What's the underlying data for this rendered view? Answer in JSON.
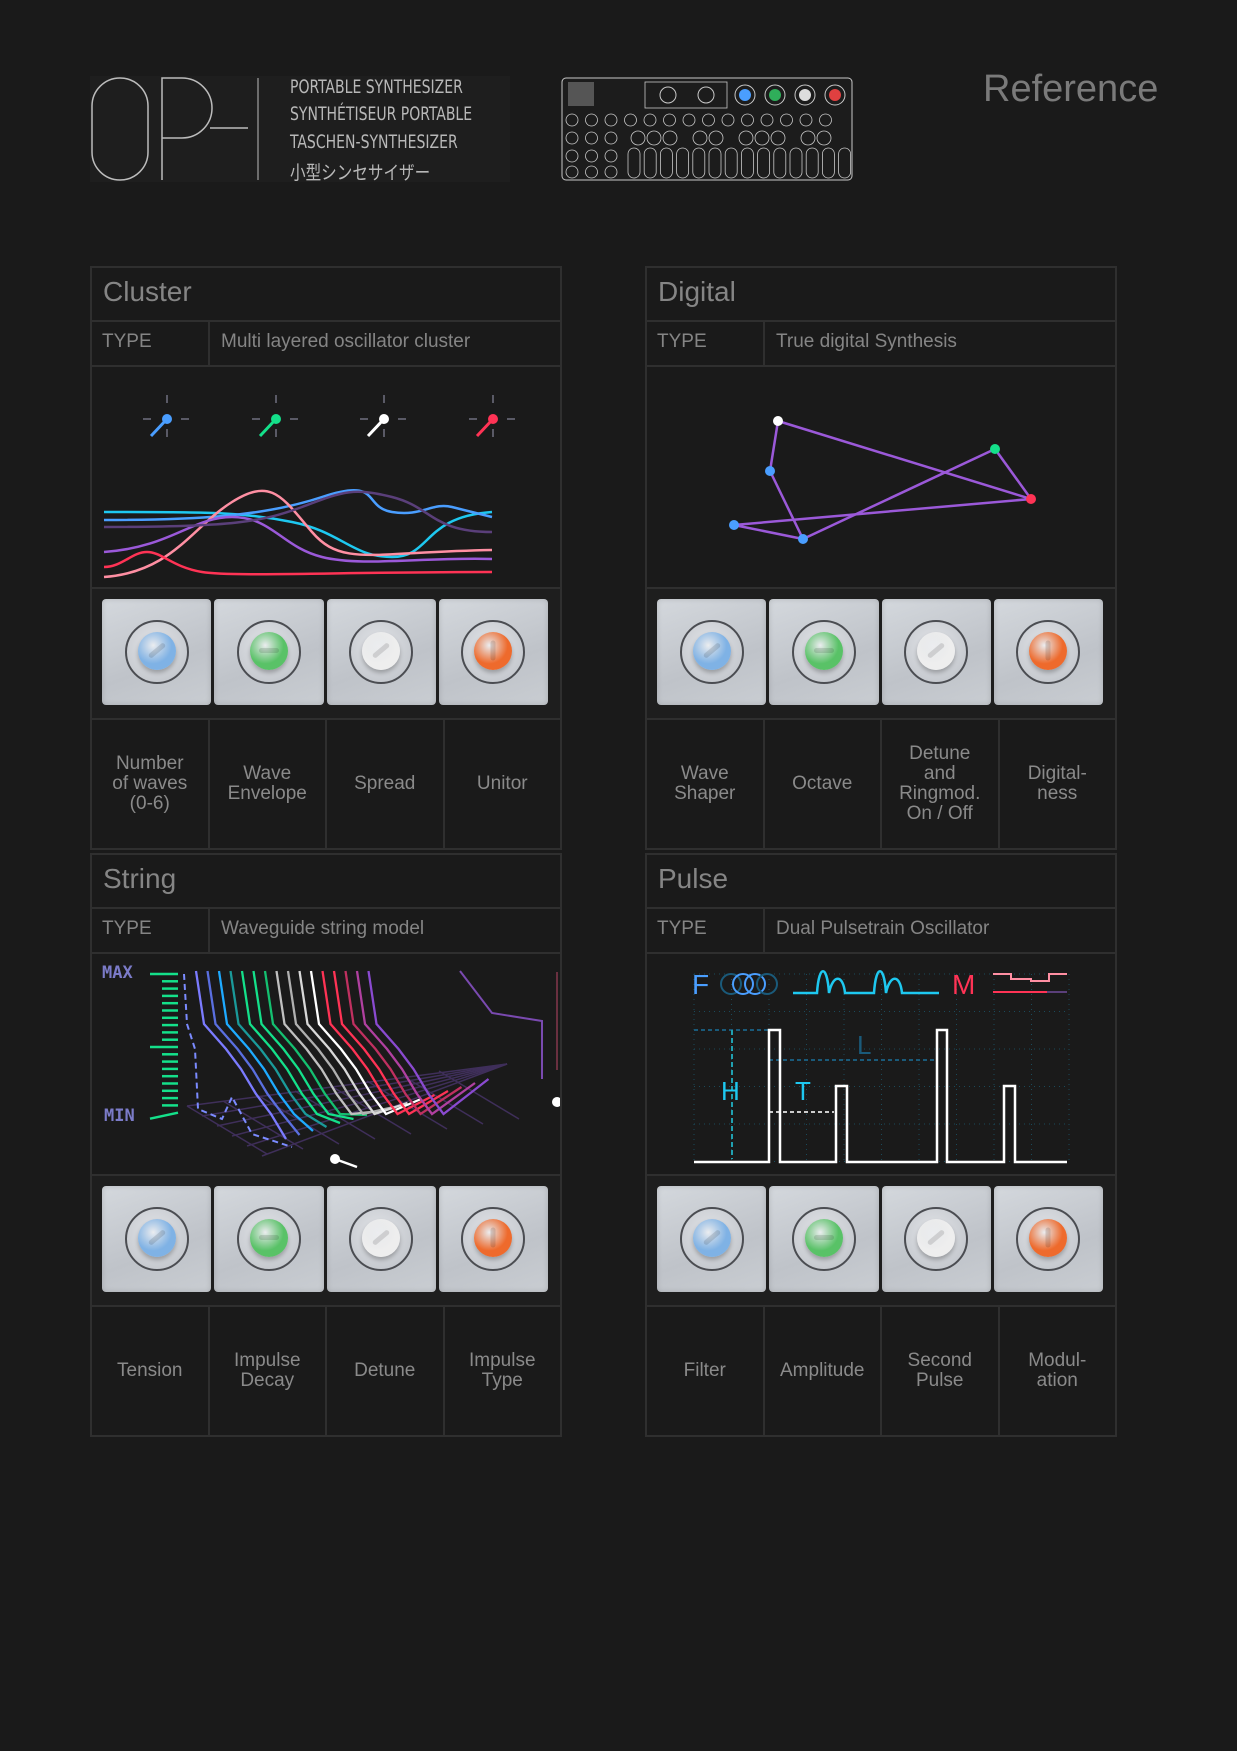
{
  "header": {
    "logo_text": "OP-",
    "taglines": [
      "PORTABLE SYNTHESIZER",
      "SYNTHÉTISEUR PORTABLE",
      "TASCHEN-SYNTHESIZER",
      "小型シンセサイザー"
    ],
    "device_illustration": "op-1-device-diagram",
    "page_title": "Reference"
  },
  "colors": {
    "background": "#1a1a1a",
    "border": "#2f2f2f",
    "text": "#858585",
    "blue": "#4a9eff",
    "green": "#14e08a",
    "white": "#ffffff",
    "red": "#ff3355",
    "purple": "#9b59d9"
  },
  "knobs": [
    {
      "name": "blue-knob",
      "color": "#7fb2e5",
      "slot": "diagonal"
    },
    {
      "name": "green-knob",
      "color": "#59c267",
      "slot": "horizontal"
    },
    {
      "name": "white-knob",
      "color": "#eeeeee",
      "slot": "diagonal"
    },
    {
      "name": "orange-knob",
      "color": "#ee6a2c",
      "slot": "vertical"
    }
  ],
  "panels": [
    {
      "id": "cluster",
      "title": "Cluster",
      "type_key": "TYPE",
      "type_value": "Multi layered oscillator cluster",
      "labels": [
        "Number\nof waves\n(0-6)",
        "Wave\nEnvelope",
        "Spread",
        "Unitor"
      ]
    },
    {
      "id": "digital",
      "title": "Digital",
      "type_key": "TYPE",
      "type_value": "True digital Synthesis",
      "labels": [
        "Wave\nShaper",
        "Octave",
        "Detune\nand\nRingmod.\nOn / Off",
        "Digital-\nness"
      ]
    },
    {
      "id": "string",
      "title": "String",
      "type_key": "TYPE",
      "type_value": "Waveguide string model",
      "labels": [
        "Tension",
        "Impulse\nDecay",
        "Detune",
        "Impulse\nType"
      ]
    },
    {
      "id": "pulse",
      "title": "Pulse",
      "type_key": "TYPE",
      "type_value": "Dual Pulsetrain Oscillator",
      "labels": [
        "Filter",
        "Amplitude",
        "Second\nPulse",
        "Modul-\nation"
      ]
    }
  ],
  "visuals": {
    "cluster": {
      "indicator_colors": [
        "#4a9eff",
        "#14e08a",
        "#ffffff",
        "#ff3355"
      ],
      "waves": [
        {
          "color": "#1ec8f0",
          "shape": "dip-right"
        },
        {
          "color": "#4a9eff",
          "shape": "double-bump"
        },
        {
          "color": "#ff8fa3",
          "shape": "peak-left"
        },
        {
          "color": "#9b59d9",
          "shape": "bump-left"
        },
        {
          "color": "#5a3f7a",
          "shape": "bump-mid"
        },
        {
          "color": "#ff3355",
          "shape": "small-bump"
        }
      ]
    },
    "digital": {
      "nodes": [
        {
          "color": "#ffffff"
        },
        {
          "color": "#4a9eff"
        },
        {
          "color": "#4a9eff"
        },
        {
          "color": "#14e08a"
        },
        {
          "color": "#ff3355"
        },
        {
          "color": "#4a9eff"
        }
      ],
      "line_color": "#9b59d9"
    },
    "string": {
      "axis_max_label": "MAX",
      "axis_min_label": "MIN",
      "axis_label_color": "#7b7bc8",
      "scale_color": "#14e08a",
      "string_colors": [
        "#7b7bff",
        "#5a6fe0",
        "#1eaaff",
        "#1a9a9a",
        "#14e08a",
        "#14e08a",
        "#14c070",
        "#c0c0c0",
        "#b0b0b0",
        "#d8d8d8",
        "#ffffff",
        "#ff3355",
        "#ff3355",
        "#c03060",
        "#b040a0",
        "#8a4ad0"
      ]
    },
    "pulse": {
      "label_f": "F",
      "label_m": "M",
      "label_h": "H",
      "label_t": "T",
      "label_l": "L",
      "f_color": "#4a9eff",
      "wave_color": "#1ec8f0",
      "m_color": "#ff3355",
      "pulse_color": "#ffffff"
    }
  }
}
